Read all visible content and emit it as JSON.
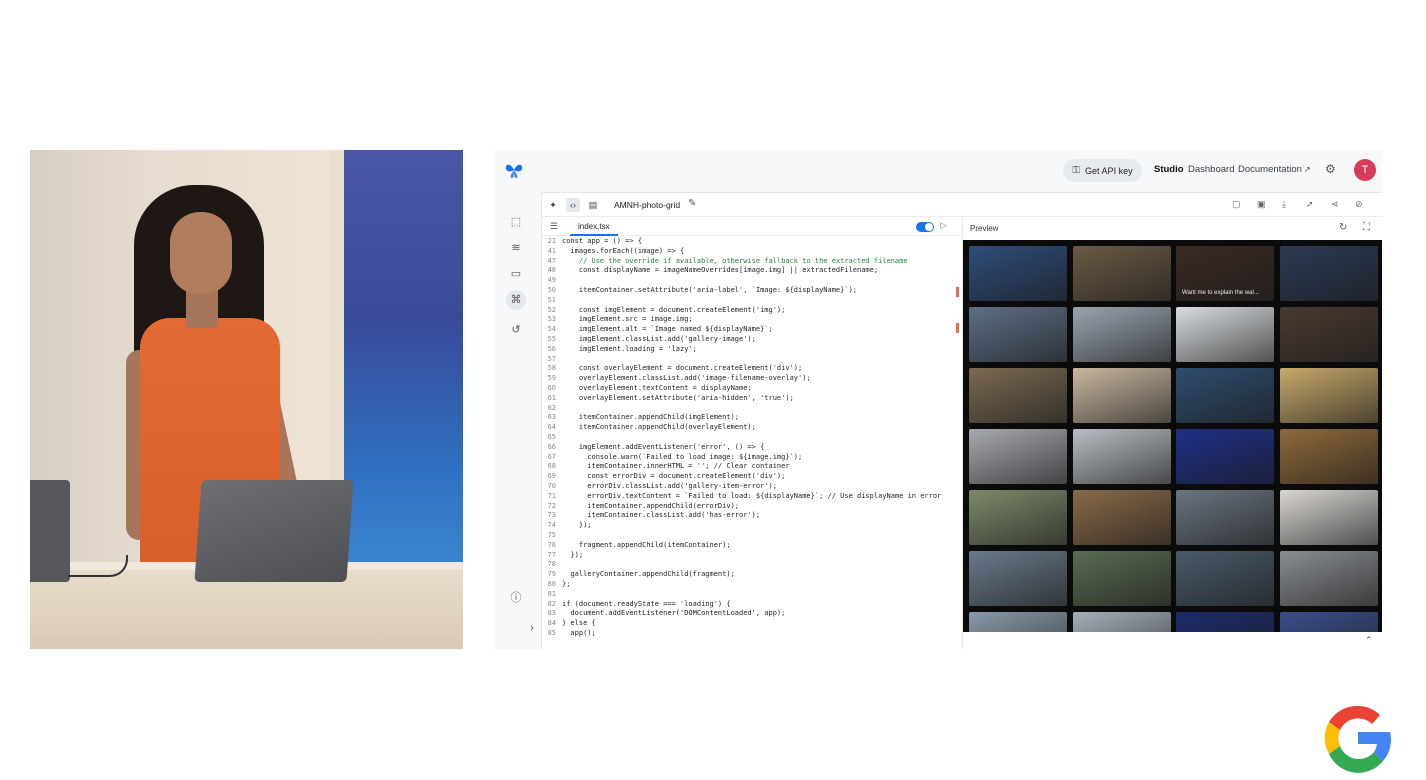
{
  "studio": {
    "header": {
      "api_key_label": "Get API key",
      "nav": {
        "studio": "Studio",
        "dashboard": "Dashboard",
        "documentation": "Documentation"
      },
      "avatar_initial": "T"
    },
    "project": {
      "name": "AMNH-photo-grid"
    },
    "editor": {
      "file_tab": "index.tsx",
      "lines": [
        {
          "n": "21",
          "t": "const app = () => {"
        },
        {
          "n": "41",
          "t": "  images.forEach((image) => {"
        },
        {
          "n": "47",
          "t": "    // Use the override if available, otherwise fallback to the extracted filename",
          "comment": true
        },
        {
          "n": "48",
          "t": "    const displayName = imageNameOverrides[image.img] || extractedFilename;"
        },
        {
          "n": "49",
          "t": ""
        },
        {
          "n": "50",
          "t": "    itemContainer.setAttribute('aria-label', `Image: ${displayName}`);"
        },
        {
          "n": "51",
          "t": ""
        },
        {
          "n": "52",
          "t": "    const imgElement = document.createElement('img');"
        },
        {
          "n": "53",
          "t": "    imgElement.src = image.img;"
        },
        {
          "n": "54",
          "t": "    imgElement.alt = `Image named ${displayName}`;"
        },
        {
          "n": "55",
          "t": "    imgElement.classList.add('gallery-image');"
        },
        {
          "n": "56",
          "t": "    imgElement.loading = 'lazy';"
        },
        {
          "n": "57",
          "t": ""
        },
        {
          "n": "58",
          "t": "    const overlayElement = document.createElement('div');"
        },
        {
          "n": "59",
          "t": "    overlayElement.classList.add('image-filename-overlay');"
        },
        {
          "n": "60",
          "t": "    overlayElement.textContent = displayName;"
        },
        {
          "n": "61",
          "t": "    overlayElement.setAttribute('aria-hidden', 'true');"
        },
        {
          "n": "62",
          "t": ""
        },
        {
          "n": "63",
          "t": "    itemContainer.appendChild(imgElement);"
        },
        {
          "n": "64",
          "t": "    itemContainer.appendChild(overlayElement);"
        },
        {
          "n": "65",
          "t": ""
        },
        {
          "n": "66",
          "t": "    imgElement.addEventListener('error', () => {"
        },
        {
          "n": "67",
          "t": "      console.warn(`Failed to load image: ${image.img}`);"
        },
        {
          "n": "68",
          "t": "      itemContainer.innerHTML = ''; // Clear container"
        },
        {
          "n": "69",
          "t": "      const errorDiv = document.createElement('div');"
        },
        {
          "n": "70",
          "t": "      errorDiv.classList.add('gallery-item-error');"
        },
        {
          "n": "71",
          "t": "      errorDiv.textContent = `Failed to load: ${displayName}`; // Use displayName in error"
        },
        {
          "n": "72",
          "t": "      itemContainer.appendChild(errorDiv);"
        },
        {
          "n": "73",
          "t": "      itemContainer.classList.add('has-error');"
        },
        {
          "n": "74",
          "t": "    });"
        },
        {
          "n": "75",
          "t": ""
        },
        {
          "n": "76",
          "t": "    fragment.appendChild(itemContainer);"
        },
        {
          "n": "77",
          "t": "  });"
        },
        {
          "n": "78",
          "t": ""
        },
        {
          "n": "79",
          "t": "  galleryContainer.appendChild(fragment);"
        },
        {
          "n": "80",
          "t": "};"
        },
        {
          "n": "81",
          "t": ""
        },
        {
          "n": "82",
          "t": "if (document.readyState === 'loading') {"
        },
        {
          "n": "83",
          "t": "  document.addEventListener('DOMContentLoaded', app);"
        },
        {
          "n": "84",
          "t": "} else {"
        },
        {
          "n": "85",
          "t": "  app();"
        }
      ]
    },
    "preview": {
      "title": "Preview",
      "tile_caption": "Want me to explain the wal...",
      "tile_colors": [
        [
          "#2f4d7a",
          "#6b5a44",
          "#3a2a24",
          "#2c3a55"
        ],
        [
          "#5e6f86",
          "#9aa4b0",
          "#d9dde0",
          "#4a3a30"
        ],
        [
          "#7a6a52",
          "#c9b7a0",
          "#2f4d6e",
          "#c7a96a"
        ],
        [
          "#a7aab0",
          "#b8bec4",
          "#1f2f8a",
          "#8f6a3a"
        ],
        [
          "#7d8a6a",
          "#8a6a48",
          "#6b7480",
          "#d9d6d2"
        ],
        [
          "#6a7a8a",
          "#5a6b52",
          "#4a5a6a",
          "#8a8e92"
        ],
        [
          "#8a9aa8",
          "#a6b0ba",
          "#1c2c6a",
          "#3a4e8a"
        ]
      ]
    }
  }
}
